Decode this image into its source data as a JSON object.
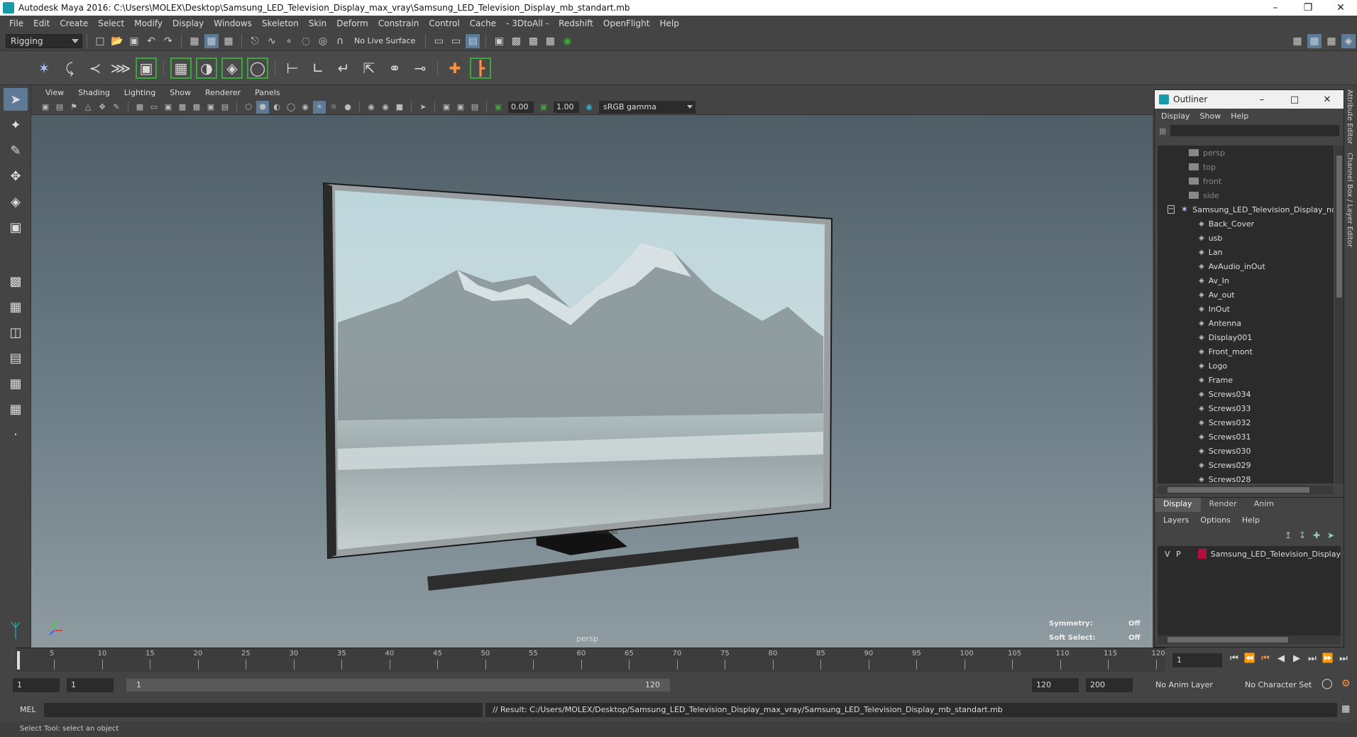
{
  "window": {
    "title": "Autodesk Maya 2016: C:\\Users\\MOLEX\\Desktop\\Samsung_LED_Television_Display_max_vray\\Samsung_LED_Television_Display_mb_standart.mb",
    "min": "–",
    "restore": "❐",
    "close": "✕"
  },
  "menubar": [
    "File",
    "Edit",
    "Create",
    "Select",
    "Modify",
    "Display",
    "Windows",
    "Skeleton",
    "Skin",
    "Deform",
    "Constrain",
    "Control",
    "Cache",
    "- 3DtoAll -",
    "Redshift",
    "OpenFlight",
    "Help"
  ],
  "statusline": {
    "mode": "Rigging",
    "live_surface": "No Live Surface"
  },
  "panel": {
    "menus": [
      "View",
      "Shading",
      "Lighting",
      "Show",
      "Renderer",
      "Panels"
    ],
    "exposure": "0.00",
    "gamma_value": "1.00",
    "color_space": "sRGB gamma"
  },
  "viewport": {
    "camera_label": "persp",
    "symmetry_label": "Symmetry:",
    "symmetry_value": "Off",
    "soft_select_label": "Soft Select:",
    "soft_select_value": "Off"
  },
  "outliner": {
    "title": "Outliner",
    "menus": [
      "Display",
      "Show",
      "Help"
    ],
    "cameras": [
      "persp",
      "top",
      "front",
      "side"
    ],
    "group": "Samsung_LED_Television_Display_ncl",
    "children": [
      "Back_Cover",
      "usb",
      "Lan",
      "AvAudio_inOut",
      "Av_In",
      "Av_out",
      "InOut",
      "Antenna",
      "Display001",
      "Front_mont",
      "Logo",
      "Frame",
      "Screws034",
      "Screws033",
      "Screws032",
      "Screws031",
      "Screws030",
      "Screws029",
      "Screws028"
    ]
  },
  "layers": {
    "tabs": [
      "Display",
      "Render",
      "Anim"
    ],
    "menus": [
      "Layers",
      "Options",
      "Help"
    ],
    "row": {
      "v": "V",
      "p": "P",
      "name": "Samsung_LED_Television_Display",
      "color": "#b0103a"
    }
  },
  "sidetabs": [
    "Attribute Editor",
    "Channel Box / Layer Editor"
  ],
  "timeline": {
    "ticks": [
      5,
      10,
      15,
      20,
      25,
      30,
      35,
      40,
      45,
      50,
      55,
      60,
      65,
      70,
      75,
      80,
      85,
      90,
      95,
      100,
      105,
      110,
      115,
      120
    ],
    "current_frame_field": "1"
  },
  "range": {
    "start": "1",
    "start2": "1",
    "handle_start": "1",
    "handle_end": "120",
    "end": "120",
    "end2": "200",
    "anim_layer": "No Anim Layer",
    "character_set": "No Character Set"
  },
  "command": {
    "lang": "MEL",
    "result": "// Result: C:/Users/MOLEX/Desktop/Samsung_LED_Television_Display_max_vray/Samsung_LED_Television_Display_mb_standart.mb"
  },
  "helpline": "Select Tool: select an object"
}
